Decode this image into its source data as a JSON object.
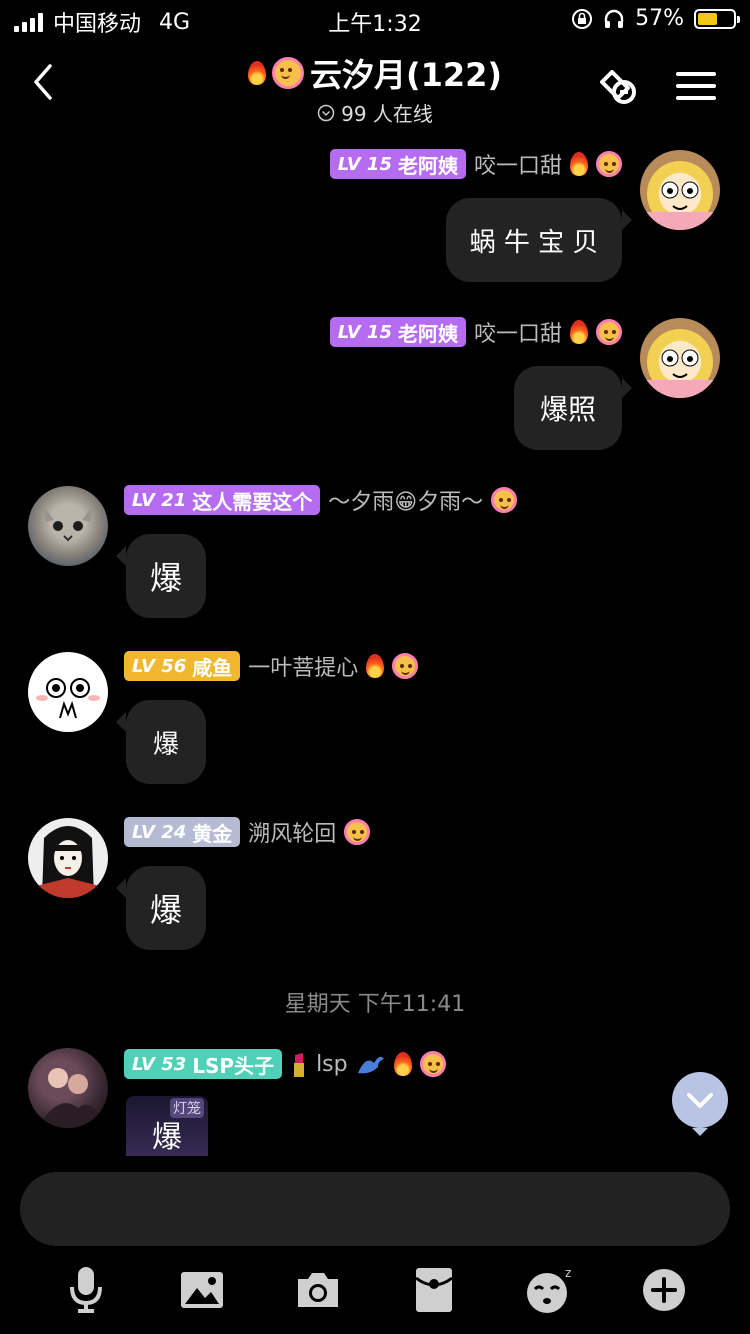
{
  "status_bar": {
    "carrier": "中国移动",
    "network": "4G",
    "time": "上午1:32",
    "battery_pct": "57%"
  },
  "header": {
    "title": "云汐月(122)",
    "online": "99 人在线"
  },
  "messages": [
    {
      "level": "LV 15",
      "badge": "老阿姨",
      "name": "咬一口甜",
      "text": "蜗 牛 宝 贝",
      "side": "right",
      "badge_color": "#b56cf0"
    },
    {
      "level": "LV 15",
      "badge": "老阿姨",
      "name": "咬一口甜",
      "text": "爆照",
      "side": "right",
      "badge_color": "#b56cf0"
    },
    {
      "level": "LV 21",
      "badge": "这人需要这个",
      "name": "～夕雨😁夕雨～",
      "text": "爆",
      "side": "left",
      "badge_color": "#b56cf0"
    },
    {
      "level": "LV 56",
      "badge": "咸鱼",
      "name": "一叶菩提心",
      "text": "爆",
      "side": "left",
      "badge_color": "#f0b72f"
    },
    {
      "level": "LV 24",
      "badge": "黄金",
      "name": "溯风轮回",
      "text": "爆",
      "side": "left",
      "badge_color": "#b4bbd3"
    },
    {
      "level": "LV 53",
      "badge": "LSP头子",
      "name": "lsp",
      "text": "爆",
      "side": "left",
      "badge_color": "#4fd0b7",
      "bubble_tag": "灯笼"
    }
  ],
  "timestamp": "星期天 下午11:41",
  "input": {
    "placeholder": ""
  },
  "toolbar": [
    "mic-icon",
    "image-icon",
    "camera-icon",
    "redpacket-icon",
    "emoji-icon",
    "plus-icon"
  ]
}
